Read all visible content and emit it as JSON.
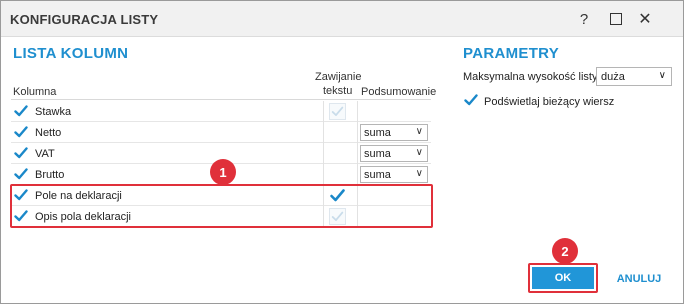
{
  "window": {
    "title": "KONFIGURACJA LISTY",
    "help_glyph": "?",
    "close_glyph": "✕"
  },
  "columns_section": {
    "title": "LISTA KOLUMN",
    "headers": {
      "column": "Kolumna",
      "wrap_line1": "Zawijanie",
      "wrap_line2": "tekstu",
      "summary": "Podsumowanie"
    },
    "rows": [
      {
        "label": "Stawka",
        "checked": true,
        "wrap": "disabled",
        "summary": ""
      },
      {
        "label": "Netto",
        "checked": true,
        "wrap": "none",
        "summary": "suma"
      },
      {
        "label": "VAT",
        "checked": true,
        "wrap": "none",
        "summary": "suma"
      },
      {
        "label": "Brutto",
        "checked": true,
        "wrap": "none",
        "summary": "suma"
      },
      {
        "label": "Pole na deklaracji",
        "checked": true,
        "wrap": "checked",
        "summary": ""
      },
      {
        "label": "Opis pola deklaracji",
        "checked": true,
        "wrap": "disabled",
        "summary": ""
      }
    ]
  },
  "params_section": {
    "title": "PARAMETRY",
    "max_height_label": "Maksymalna wysokość listy:",
    "max_height_value": "duża",
    "highlight_label": "Podświetlaj bieżący wiersz",
    "highlight_checked": true
  },
  "annotations": {
    "badge_1": "1",
    "badge_2": "2",
    "color": "#e0303a"
  },
  "buttons": {
    "ok": "OK",
    "cancel": "ANULUJ"
  },
  "colors": {
    "accent": "#1f8fcf",
    "ok_bg": "#2196d8",
    "check": "#1a88c9"
  }
}
